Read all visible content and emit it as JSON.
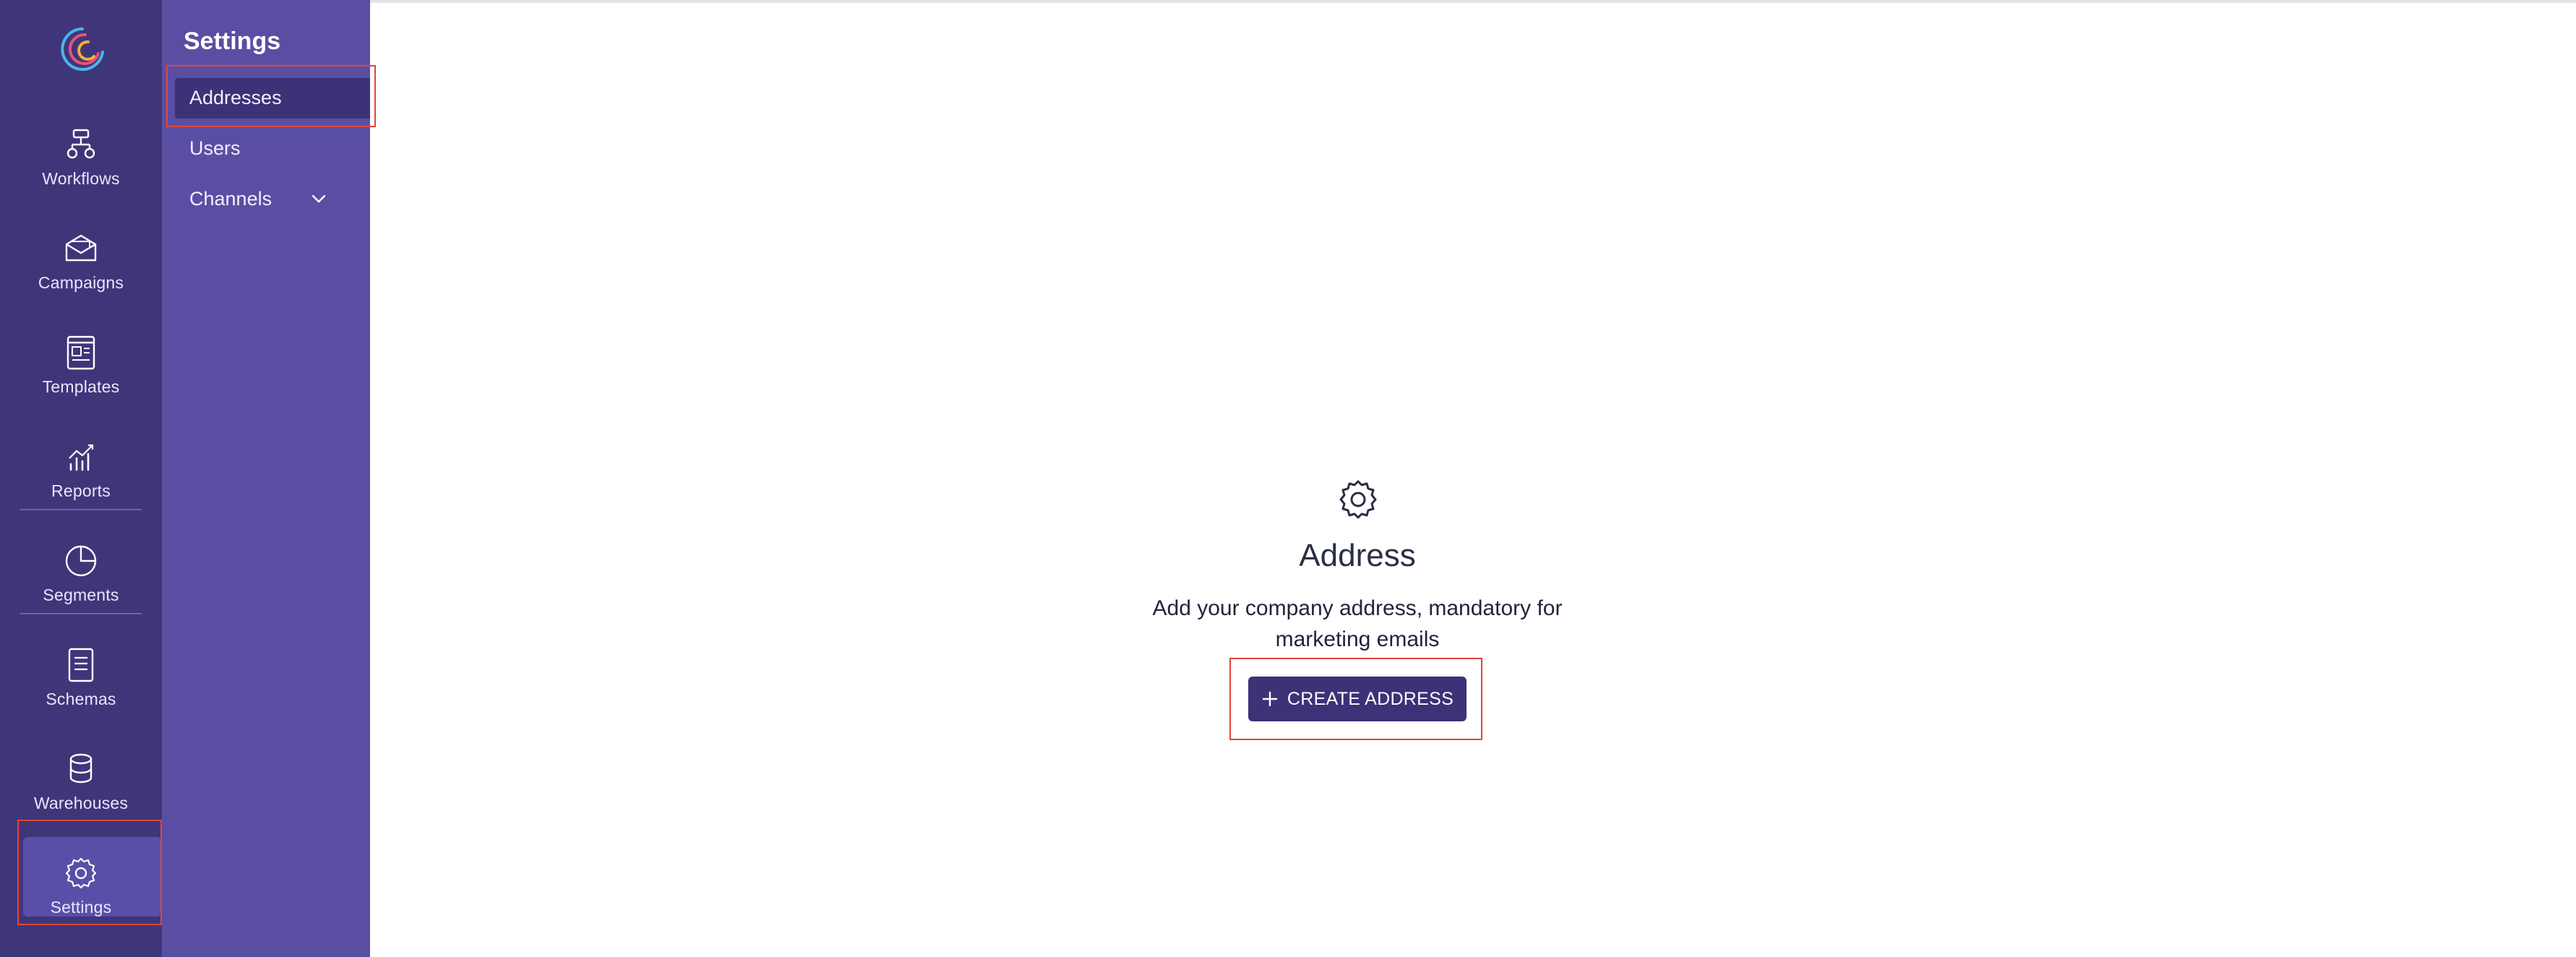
{
  "rail": {
    "logo_icon": "swirl-logo",
    "items": [
      {
        "label": "Workflows",
        "icon": "workflow-icon"
      },
      {
        "label": "Campaigns",
        "icon": "envelope-icon"
      },
      {
        "label": "Templates",
        "icon": "template-icon"
      },
      {
        "label": "Reports",
        "icon": "chart-icon"
      },
      {
        "label": "Segments",
        "icon": "pie-icon"
      },
      {
        "label": "Schemas",
        "icon": "document-icon"
      },
      {
        "label": "Warehouses",
        "icon": "database-icon"
      },
      {
        "label": "Settings",
        "icon": "gear-icon"
      }
    ],
    "active": "Settings"
  },
  "panel": {
    "title": "Settings",
    "items": [
      {
        "label": "Addresses"
      },
      {
        "label": "Users"
      },
      {
        "label": "Channels"
      }
    ],
    "active": "Addresses"
  },
  "empty_state": {
    "icon": "gear-icon",
    "title": "Address",
    "description": "Add your company address, mandatory for marketing emails",
    "button_label": "CREATE ADDRESS"
  },
  "colors": {
    "rail_bg": "#3f3679",
    "panel_bg": "#5a4ea3",
    "accent": "#3b3277",
    "highlight_box": "#e0463b"
  }
}
